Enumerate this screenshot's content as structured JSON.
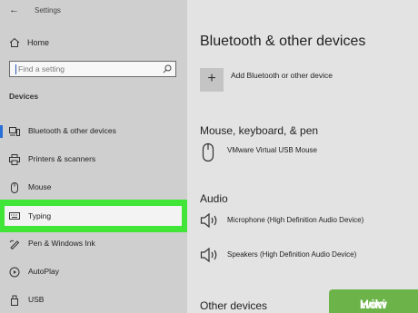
{
  "titlebar": {
    "back_icon": "back-arrow-icon",
    "title": "Settings"
  },
  "sidebar": {
    "home_label": "Home",
    "search_placeholder": "Find a setting",
    "section_title": "Devices",
    "items": [
      {
        "label": "Bluetooth & other devices",
        "icon": "bluetooth-devices-icon"
      },
      {
        "label": "Printers & scanners",
        "icon": "printer-icon"
      },
      {
        "label": "Mouse",
        "icon": "mouse-icon"
      },
      {
        "label": "Typing",
        "icon": "keyboard-icon"
      },
      {
        "label": "Pen & Windows Ink",
        "icon": "pen-icon"
      },
      {
        "label": "AutoPlay",
        "icon": "autoplay-icon"
      },
      {
        "label": "USB",
        "icon": "usb-icon"
      }
    ],
    "highlight_color": "#41e537"
  },
  "main": {
    "title": "Bluetooth & other devices",
    "add_label": "Add Bluetooth or other device",
    "mouse_section": "Mouse, keyboard, & pen",
    "mouse_device": "VMware Virtual USB Mouse",
    "audio_section": "Audio",
    "audio_devices": [
      "Microphone (High Definition Audio Device)",
      "Speakers (High Definition Audio Device)"
    ],
    "other_section": "Other devices"
  },
  "watermark": {
    "part1": "wiki",
    "part2": "How"
  }
}
